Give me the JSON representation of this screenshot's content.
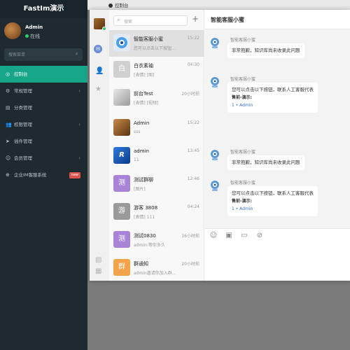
{
  "admin": {
    "brand": "FastIm演示",
    "user_name": "Admin",
    "user_status": "在线",
    "search_placeholder": "搜索菜单",
    "nav": [
      {
        "icon": "◎",
        "label": "控制台",
        "arrow": "",
        "badge": ""
      },
      {
        "icon": "⚙",
        "label": "常规管理",
        "arrow": "‹",
        "badge": ""
      },
      {
        "icon": "▤",
        "label": "分类管理",
        "arrow": "",
        "badge": ""
      },
      {
        "icon": "👥",
        "label": "权限管理",
        "arrow": "‹",
        "badge": ""
      },
      {
        "icon": "➤",
        "label": "插件管理",
        "arrow": "",
        "badge": ""
      },
      {
        "icon": "☺",
        "label": "会员管理",
        "arrow": "‹",
        "badge": ""
      },
      {
        "icon": "⊕",
        "label": "企业IM客服系统",
        "arrow": "",
        "badge": "new"
      }
    ]
  },
  "topbar": {
    "tab_label": "控制台"
  },
  "chat": {
    "search_placeholder": "搜索",
    "add_symbol": "+",
    "title": "智能客服小蜜",
    "conversations": [
      {
        "name": "智能客服小蜜",
        "time": "15:22",
        "sub": "您可以点击以下按钮...",
        "avatar_text": "",
        "avatar_color": "#4aa0e6",
        "active": true
      },
      {
        "name": "白衣素袖",
        "time": "04:30",
        "sub": "[表情] [图]",
        "avatar_text": "白",
        "avatar_color": "#d0d0d0",
        "active": false
      },
      {
        "name": "前台Test",
        "time": "20小时前",
        "sub": "[表情] [视频]",
        "avatar_text": "",
        "avatar_color": "#c9c9c9",
        "active": false
      },
      {
        "name": "Admin",
        "time": "15:22",
        "sub": "sss",
        "avatar_text": "",
        "avatar_color": "#8a5020",
        "active": false
      },
      {
        "name": "admin",
        "time": "13:45",
        "sub": "11",
        "avatar_text": "",
        "avatar_color": "#1d5bb8",
        "active": false
      },
      {
        "name": "测试群聊",
        "time": "12:46",
        "sub": "[图片]",
        "avatar_text": "测",
        "avatar_color": "#a983d6",
        "active": false
      },
      {
        "name": "游客 3808",
        "time": "04:24",
        "sub": "[表情] 111",
        "avatar_text": "游",
        "avatar_color": "#9a9a9a",
        "active": false
      },
      {
        "name": "测试0830",
        "time": "16小时前",
        "sub": "admin:等你多久",
        "avatar_text": "测",
        "avatar_color": "#a983d6",
        "active": false
      },
      {
        "name": "群通知",
        "time": "20小时前",
        "sub": "admin邀请你加入群...",
        "avatar_text": "群",
        "avatar_color": "#f3a34a",
        "active": false
      }
    ],
    "messages": [
      {
        "sender": "智能客服小蜜",
        "line1": "非常抱歉，知识库尚未收录此问题",
        "line2": "",
        "line3": ""
      },
      {
        "sender": "智能客服小蜜",
        "line1": "您可以点击以下按钮，联系人工客服代表",
        "line2": "售前-演示:",
        "line3": "1 • Admin"
      },
      {
        "sender": "智能客服小蜜",
        "line1": "非常抱歉，知识库尚未收录此问题",
        "line2": "",
        "line3": ""
      },
      {
        "sender": "智能客服小蜜",
        "line1": "您可以点击以下按钮，联系人工客服代表",
        "line2": "售前-演示:",
        "line3": "1 • Admin"
      }
    ],
    "toolbar": [
      "☺",
      "▣",
      "▭",
      "⊘"
    ]
  }
}
